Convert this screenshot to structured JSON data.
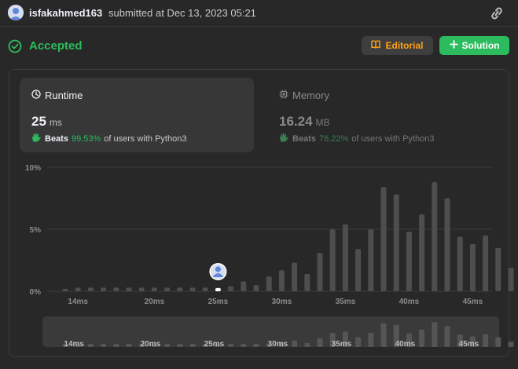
{
  "header": {
    "username": "isfakahmed163",
    "submitted_text": "submitted at Dec 13, 2023 05:21"
  },
  "status": {
    "text": "Accepted",
    "color": "#2cbb5d"
  },
  "buttons": {
    "editorial": "Editorial",
    "solution": "Solution"
  },
  "runtime": {
    "title": "Runtime",
    "value": "25",
    "unit": "ms",
    "beats_label": "Beats",
    "beats_pct": "99.53%",
    "beats_suffix": "of users with Python3"
  },
  "memory": {
    "title": "Memory",
    "value": "16.24",
    "unit": "MB",
    "beats_label": "Beats",
    "beats_pct": "76.22%",
    "beats_suffix": "of users with Python3"
  },
  "colors": {
    "accent_green": "#2cbb5d",
    "accent_orange": "#ffa116",
    "bar": "#4e4e4e",
    "bar_minimap": "#555555",
    "marker": "#ffffff"
  },
  "icons": {
    "link": "link-icon",
    "check": "check-circle-icon",
    "book": "book-icon",
    "plus": "plus-icon",
    "clock": "clock-icon",
    "chip": "chip-icon",
    "clap": "clap-icon"
  },
  "chart_data": {
    "type": "bar",
    "x_unit": "ms",
    "x": [
      13,
      14,
      15,
      16,
      17,
      18,
      19,
      20,
      21,
      22,
      23,
      24,
      25,
      26,
      27,
      28,
      29,
      30,
      31,
      32,
      33,
      34,
      35,
      36,
      37,
      38,
      39,
      40,
      41,
      42,
      43,
      44,
      45,
      46,
      47,
      48
    ],
    "values": [
      0.2,
      0.3,
      0.3,
      0.3,
      0.3,
      0.3,
      0.3,
      0.3,
      0.3,
      0.3,
      0.3,
      0.3,
      0.3,
      0.4,
      0.8,
      0.5,
      1.2,
      1.7,
      2.3,
      1.4,
      3.1,
      5.0,
      5.4,
      3.4,
      5.0,
      8.4,
      7.8,
      4.8,
      6.2,
      8.8,
      7.5,
      4.4,
      3.8,
      4.5,
      3.5,
      1.9
    ],
    "x_ticks": [
      "14ms",
      "20ms",
      "25ms",
      "30ms",
      "35ms",
      "40ms",
      "45ms"
    ],
    "x_tick_values": [
      14,
      20,
      25,
      30,
      35,
      40,
      45
    ],
    "y_ticks": [
      "0%",
      "5%",
      "10%"
    ],
    "y_tick_values": [
      0,
      5,
      10
    ],
    "ylim": [
      0,
      10
    ],
    "highlight_x": 25,
    "grid": true
  }
}
